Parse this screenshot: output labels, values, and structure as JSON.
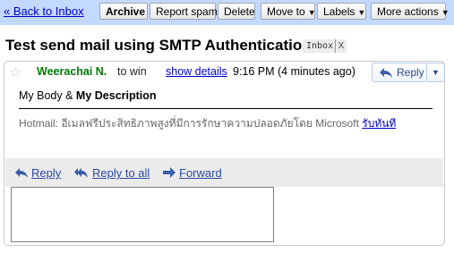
{
  "toolbar": {
    "back_label": "« Back to Inbox",
    "archive_label": "Archive",
    "report_spam_label": "Report spam",
    "delete_label": "Delete",
    "move_to_label": "Move to",
    "labels_label": "Labels",
    "more_actions_label": "More actions",
    "caret": "▼"
  },
  "subject": {
    "text": "Test send mail using SMTP Authentication",
    "label": "Inbox",
    "label_remove": "X"
  },
  "message": {
    "sender_name": "Weerachai N.",
    "to_text": "to win",
    "show_details_label": "show details",
    "time": "9:16 PM (4 minutes ago)",
    "reply_label": "Reply",
    "reply_menu_caret": "▼",
    "body_plain": "My Body & ",
    "body_bold": "My Description",
    "footer_text": "Hotmail: อีเมลฟรีประสิทธิภาพสูงที่มีการรักษาความปลอดภัยโดย Microsoft",
    "footer_link": "รับทันที",
    "star_glyph": "☆"
  },
  "actions": {
    "reply_label": "Reply",
    "reply_all_label": "Reply to all",
    "forward_label": "Forward"
  },
  "colors": {
    "toolbar_bg": "#c3d9ff",
    "sender": "#007a00",
    "link": "#0000cc",
    "action_link": "#2a4aa0"
  }
}
